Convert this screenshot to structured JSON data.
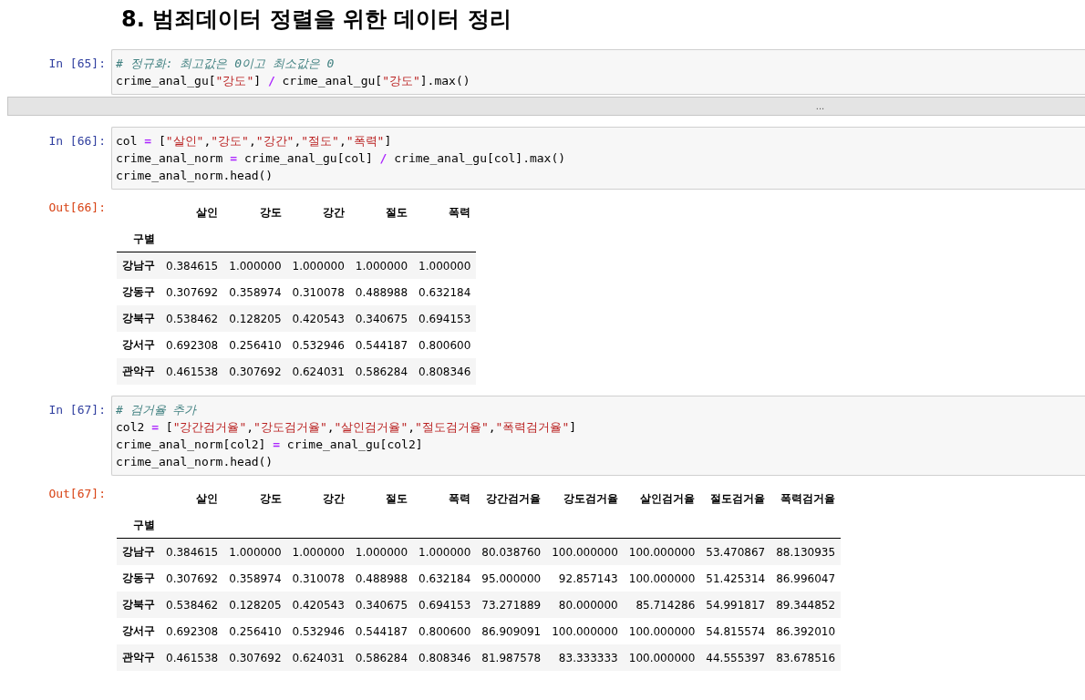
{
  "heading": "8. 범죄데이터 정렬을 위한 데이터 정리",
  "cells": [
    {
      "kind": "code",
      "prompt": "In [65]:",
      "lines": [
        [
          {
            "kind": "comment",
            "s": "# 정규화: 최고값은 0이고 최소값은 0"
          }
        ],
        [
          {
            "kind": "plain",
            "s": "crime_anal_gu["
          },
          {
            "kind": "string",
            "s": "\"강도\""
          },
          {
            "kind": "plain",
            "s": "] "
          },
          {
            "kind": "operator",
            "s": "/"
          },
          {
            "kind": "plain",
            "s": " crime_anal_gu["
          },
          {
            "kind": "string",
            "s": "\"강도\""
          },
          {
            "kind": "plain",
            "s": "].max()"
          }
        ]
      ]
    },
    {
      "kind": "collapsed",
      "label": "..."
    },
    {
      "kind": "code",
      "prompt": "In [66]:",
      "lines": [
        [
          {
            "kind": "plain",
            "s": "col "
          },
          {
            "kind": "operator",
            "s": "="
          },
          {
            "kind": "plain",
            "s": " ["
          },
          {
            "kind": "string",
            "s": "\"살인\""
          },
          {
            "kind": "plain",
            "s": ","
          },
          {
            "kind": "string",
            "s": "\"강도\""
          },
          {
            "kind": "plain",
            "s": ","
          },
          {
            "kind": "string",
            "s": "\"강간\""
          },
          {
            "kind": "plain",
            "s": ","
          },
          {
            "kind": "string",
            "s": "\"절도\""
          },
          {
            "kind": "plain",
            "s": ","
          },
          {
            "kind": "string",
            "s": "\"폭력\""
          },
          {
            "kind": "plain",
            "s": "]"
          }
        ],
        [
          {
            "kind": "plain",
            "s": "crime_anal_norm "
          },
          {
            "kind": "operator",
            "s": "="
          },
          {
            "kind": "plain",
            "s": " crime_anal_gu[col] "
          },
          {
            "kind": "operator",
            "s": "/"
          },
          {
            "kind": "plain",
            "s": " crime_anal_gu[col].max()"
          }
        ],
        [
          {
            "kind": "plain",
            "s": "crime_anal_norm.head()"
          }
        ]
      ]
    },
    {
      "kind": "table",
      "prompt": "Out[66]:",
      "index_name": "구별",
      "columns": [
        "살인",
        "강도",
        "강간",
        "절도",
        "폭력"
      ],
      "rows": [
        {
          "index": "강남구",
          "values": [
            "0.384615",
            "1.000000",
            "1.000000",
            "1.000000",
            "1.000000"
          ]
        },
        {
          "index": "강동구",
          "values": [
            "0.307692",
            "0.358974",
            "0.310078",
            "0.488988",
            "0.632184"
          ]
        },
        {
          "index": "강북구",
          "values": [
            "0.538462",
            "0.128205",
            "0.420543",
            "0.340675",
            "0.694153"
          ]
        },
        {
          "index": "강서구",
          "values": [
            "0.692308",
            "0.256410",
            "0.532946",
            "0.544187",
            "0.800600"
          ]
        },
        {
          "index": "관악구",
          "values": [
            "0.461538",
            "0.307692",
            "0.624031",
            "0.586284",
            "0.808346"
          ]
        }
      ]
    },
    {
      "kind": "code",
      "prompt": "In [67]:",
      "lines": [
        [
          {
            "kind": "comment",
            "s": "# 검거율 추가"
          }
        ],
        [
          {
            "kind": "plain",
            "s": "col2 "
          },
          {
            "kind": "operator",
            "s": "="
          },
          {
            "kind": "plain",
            "s": " ["
          },
          {
            "kind": "string",
            "s": "\"강간검거율\""
          },
          {
            "kind": "plain",
            "s": ","
          },
          {
            "kind": "string",
            "s": "\"강도검거율\""
          },
          {
            "kind": "plain",
            "s": ","
          },
          {
            "kind": "string",
            "s": "\"살인검거율\""
          },
          {
            "kind": "plain",
            "s": ","
          },
          {
            "kind": "string",
            "s": "\"절도검거율\""
          },
          {
            "kind": "plain",
            "s": ","
          },
          {
            "kind": "string",
            "s": "\"폭력검거율\""
          },
          {
            "kind": "plain",
            "s": "]"
          }
        ],
        [
          {
            "kind": "plain",
            "s": "crime_anal_norm[col2] "
          },
          {
            "kind": "operator",
            "s": "="
          },
          {
            "kind": "plain",
            "s": " crime_anal_gu[col2]"
          }
        ],
        [
          {
            "kind": "plain",
            "s": "crime_anal_norm.head()"
          }
        ]
      ]
    },
    {
      "kind": "table",
      "prompt": "Out[67]:",
      "index_name": "구별",
      "columns": [
        "살인",
        "강도",
        "강간",
        "절도",
        "폭력",
        "강간검거율",
        "강도검거율",
        "살인검거율",
        "절도검거율",
        "폭력검거율"
      ],
      "rows": [
        {
          "index": "강남구",
          "values": [
            "0.384615",
            "1.000000",
            "1.000000",
            "1.000000",
            "1.000000",
            "80.038760",
            "100.000000",
            "100.000000",
            "53.470867",
            "88.130935"
          ]
        },
        {
          "index": "강동구",
          "values": [
            "0.307692",
            "0.358974",
            "0.310078",
            "0.488988",
            "0.632184",
            "95.000000",
            "92.857143",
            "100.000000",
            "51.425314",
            "86.996047"
          ]
        },
        {
          "index": "강북구",
          "values": [
            "0.538462",
            "0.128205",
            "0.420543",
            "0.340675",
            "0.694153",
            "73.271889",
            "80.000000",
            "85.714286",
            "54.991817",
            "89.344852"
          ]
        },
        {
          "index": "강서구",
          "values": [
            "0.692308",
            "0.256410",
            "0.532946",
            "0.544187",
            "0.800600",
            "86.909091",
            "100.000000",
            "100.000000",
            "54.815574",
            "86.392010"
          ]
        },
        {
          "index": "관악구",
          "values": [
            "0.461538",
            "0.307692",
            "0.624031",
            "0.586284",
            "0.808346",
            "81.987578",
            "83.333333",
            "100.000000",
            "44.555397",
            "83.678516"
          ]
        }
      ]
    }
  ]
}
